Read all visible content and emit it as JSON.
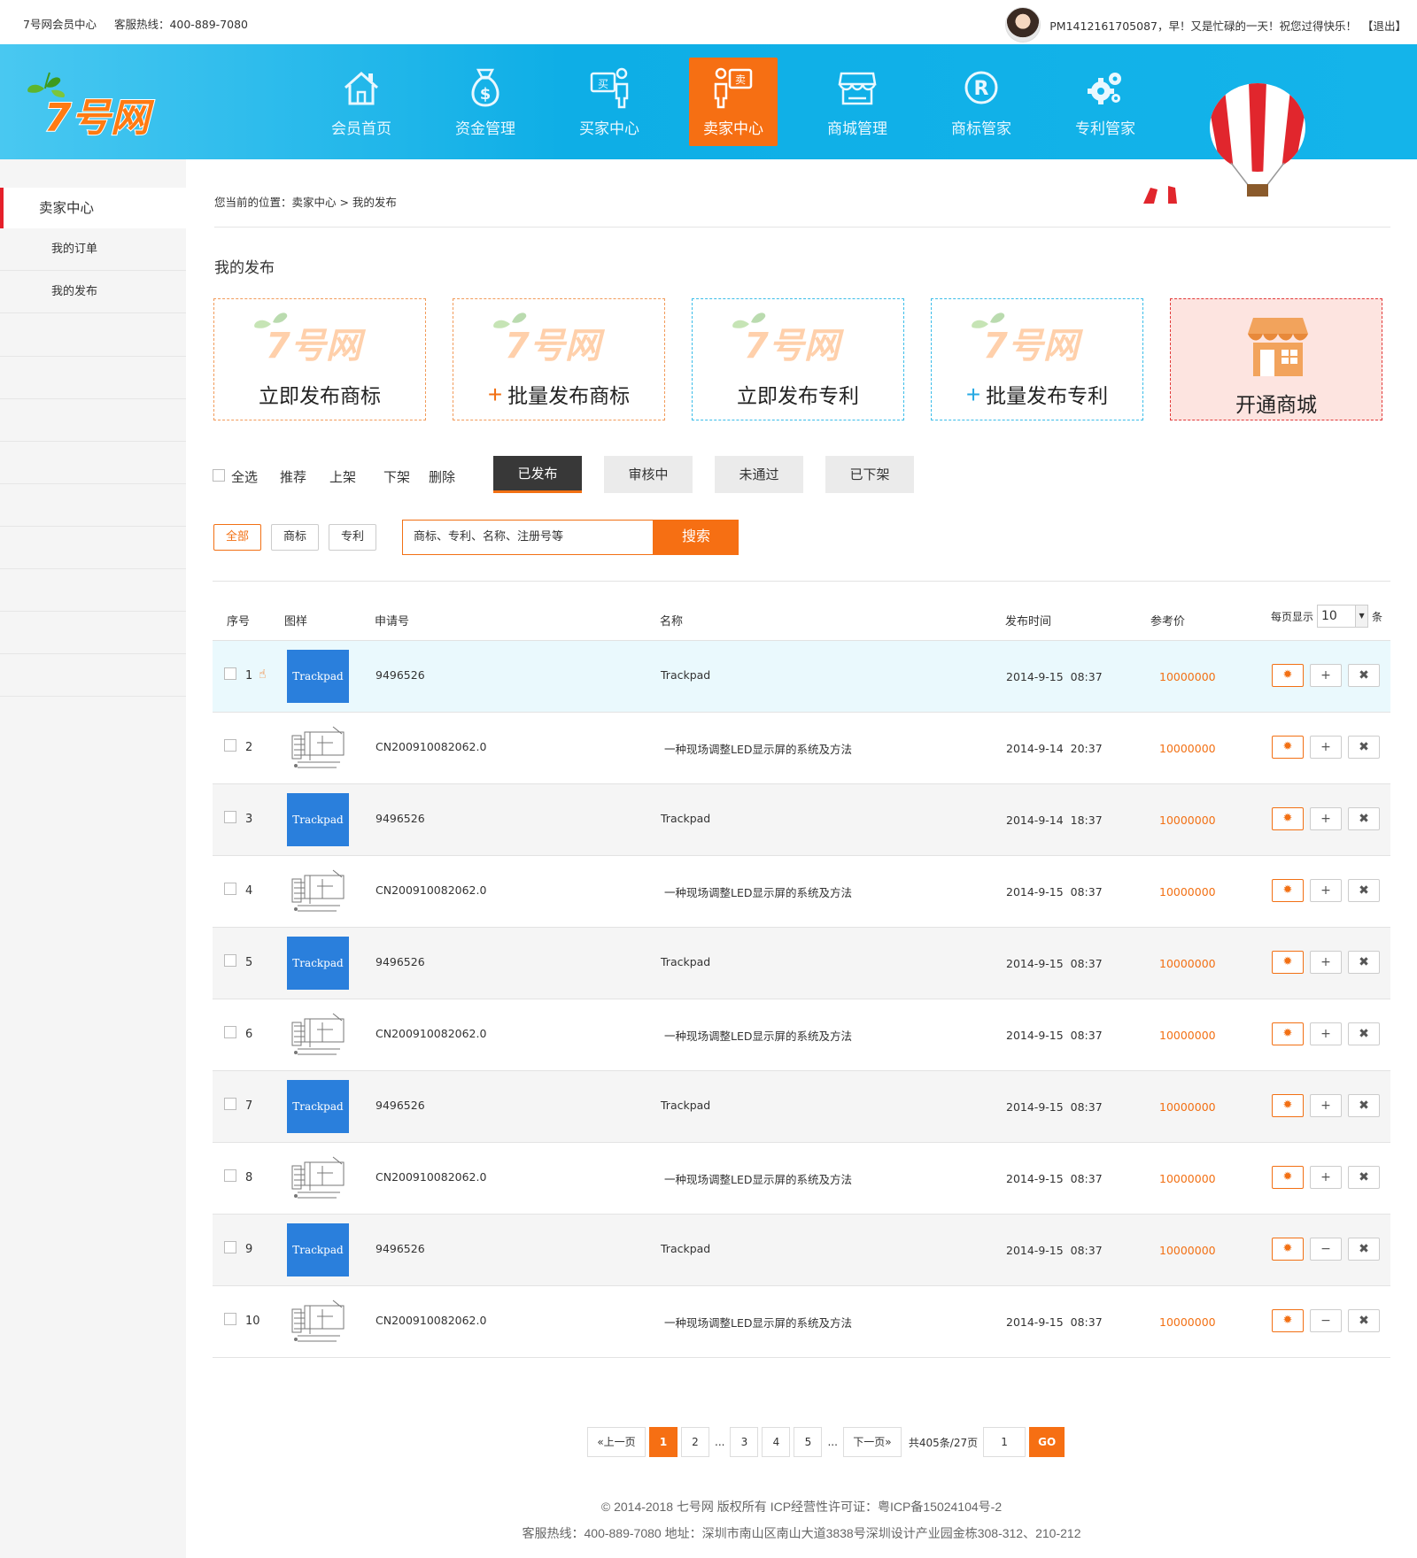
{
  "topbar": {
    "site": "7号网会员中心",
    "hotline": "客服热线：400-889-7080",
    "greeting": "PM1412161705087，早！又是忙碌的一天！祝您过得快乐！",
    "logout": "【退出】"
  },
  "nav": [
    {
      "label": "会员首页",
      "icon": "home-icon"
    },
    {
      "label": "资金管理",
      "icon": "money-bag-icon"
    },
    {
      "label": "买家中心",
      "icon": "buyer-icon"
    },
    {
      "label": "卖家中心",
      "icon": "seller-icon",
      "active": true
    },
    {
      "label": "商城管理",
      "icon": "store-icon"
    },
    {
      "label": "商标管家",
      "icon": "registered-icon"
    },
    {
      "label": "专利管家",
      "icon": "gears-icon"
    }
  ],
  "sidebar": {
    "head": "卖家中心",
    "items": [
      "我的订单",
      "我的发布"
    ]
  },
  "breadcrumb": "您当前的位置：卖家中心 > 我的发布",
  "section_title": "我的发布",
  "publish_cards": [
    {
      "label": "立即发布商标",
      "plus": false
    },
    {
      "label": "批量发布商标",
      "plus": true
    },
    {
      "label": "立即发布专利",
      "plus": false
    },
    {
      "label": "批量发布专利",
      "plus": true
    },
    {
      "label": "开通商城"
    }
  ],
  "toolbar": {
    "select_all": "全选",
    "recommend": "推荐",
    "on_shelf": "上架",
    "off_shelf": "下架",
    "delete": "删除",
    "status_tabs": [
      "已发布",
      "审核中",
      "未通过",
      "已下架"
    ]
  },
  "filter_tabs": [
    "全部",
    "商标",
    "专利"
  ],
  "search": {
    "placeholder": "商标、专利、名称、注册号等",
    "button": "搜索"
  },
  "table": {
    "headers": [
      "序号",
      "图样",
      "申请号",
      "名称",
      "发布时间",
      "参考价"
    ],
    "per_page_label": "每页显示",
    "per_page_value": "10",
    "per_page_unit": "条",
    "rows": [
      {
        "no": "1",
        "type": "tm",
        "thumb": "Trackpad",
        "app": "9496526",
        "name": "Trackpad",
        "date": "2014-9-15",
        "time": "08:37",
        "price": "10000000",
        "toggle": "+"
      },
      {
        "no": "2",
        "type": "pt",
        "app": "CN200910082062.0",
        "name": "一种现场调整LED显示屏的系统及方法",
        "date": "2014-9-14",
        "time": "20:37",
        "price": "10000000",
        "toggle": "+"
      },
      {
        "no": "3",
        "type": "tm",
        "thumb": "Trackpad",
        "app": "9496526",
        "name": "Trackpad",
        "date": "2014-9-14",
        "time": "18:37",
        "price": "10000000",
        "toggle": "+"
      },
      {
        "no": "4",
        "type": "pt",
        "app": "CN200910082062.0",
        "name": "一种现场调整LED显示屏的系统及方法",
        "date": "2014-9-15",
        "time": "08:37",
        "price": "10000000",
        "toggle": "+"
      },
      {
        "no": "5",
        "type": "tm",
        "thumb": "Trackpad",
        "app": "9496526",
        "name": "Trackpad",
        "date": "2014-9-15",
        "time": "08:37",
        "price": "10000000",
        "toggle": "+"
      },
      {
        "no": "6",
        "type": "pt",
        "app": "CN200910082062.0",
        "name": "一种现场调整LED显示屏的系统及方法",
        "date": "2014-9-15",
        "time": "08:37",
        "price": "10000000",
        "toggle": "+"
      },
      {
        "no": "7",
        "type": "tm",
        "thumb": "Trackpad",
        "app": "9496526",
        "name": "Trackpad",
        "date": "2014-9-15",
        "time": "08:37",
        "price": "10000000",
        "toggle": "+"
      },
      {
        "no": "8",
        "type": "pt",
        "app": "CN200910082062.0",
        "name": "一种现场调整LED显示屏的系统及方法",
        "date": "2014-9-15",
        "time": "08:37",
        "price": "10000000",
        "toggle": "+"
      },
      {
        "no": "9",
        "type": "tm",
        "thumb": "Trackpad",
        "app": "9496526",
        "name": "Trackpad",
        "date": "2014-9-15",
        "time": "08:37",
        "price": "10000000",
        "toggle": "−"
      },
      {
        "no": "10",
        "type": "pt",
        "app": "CN200910082062.0",
        "name": "一种现场调整LED显示屏的系统及方法",
        "date": "2014-9-15",
        "time": "08:37",
        "price": "10000000",
        "toggle": "−"
      }
    ]
  },
  "pagination": {
    "prev": "«上一页",
    "pages": [
      "1",
      "2",
      "3",
      "4",
      "5"
    ],
    "current": "1",
    "ellipsis": "...",
    "next": "下一页»",
    "summary": "共405条/27页",
    "jump_value": "1",
    "go": "GO"
  },
  "footer": {
    "line1": "© 2014-2018 七号网 版权所有 ICP经营性许可证：粤ICP备15024104号-2",
    "line2": "客服热线：400-889-7080   地址：深圳市南山区南山大道3838号深圳设计产业园金栋308-312、210-212"
  },
  "colors": {
    "accent": "#f66f13",
    "header": "#14b4ea",
    "active_side": "#e5202a"
  }
}
